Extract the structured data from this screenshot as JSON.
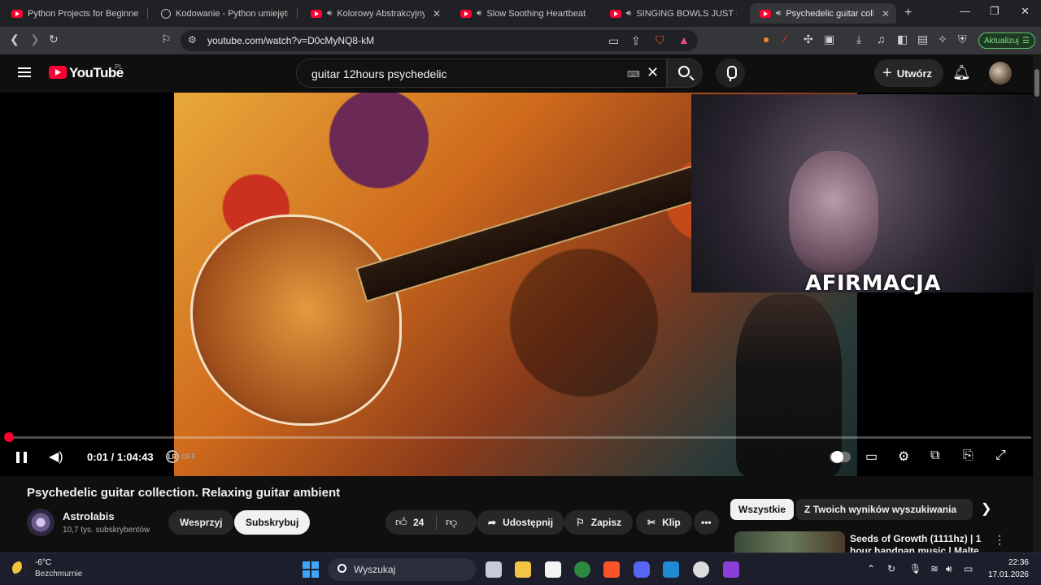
{
  "browser": {
    "tabs": [
      {
        "title": "Python Projects for Beginners –",
        "icon": "youtube-icon",
        "audio": false
      },
      {
        "title": "Kodowanie - Python umiejętność",
        "icon": "globe-icon",
        "audio": false
      },
      {
        "title": "Kolorowy Abstrakcyjny",
        "icon": "youtube-icon",
        "audio": true
      },
      {
        "title": "Slow Soothing Heartbeat So",
        "icon": "youtube-icon",
        "audio": true
      },
      {
        "title": "SINGING BOWLS JUST FOR",
        "icon": "youtube-icon",
        "audio": true
      },
      {
        "title": "Psychedelic guitar collec",
        "icon": "youtube-icon",
        "audio": true,
        "active": true
      }
    ],
    "url": "youtube.com/watch?v=D0cMyNQ8-kM",
    "update_label": "Aktualizuj"
  },
  "masthead": {
    "logo_text": "YouTube",
    "country_code": "PL",
    "search_query": "guitar 12hours psychedelic",
    "create_label": "Utwórz"
  },
  "player": {
    "overlay_text": "AFIRMACJA",
    "time_current": "0:01",
    "time_total": "1:04:43",
    "time_display": "0:01 / 1:04:43",
    "progress_fraction": 0.0003,
    "lr_label": "LR",
    "lr_state": "OFF"
  },
  "video": {
    "title": "Psychedelic guitar collection. Relaxing guitar ambient",
    "channel_name": "Astrolabis",
    "channel_subs": "10,7 tys. subskrybentów",
    "join_label": "Wesprzyj",
    "subscribe_label": "Subskrybuj",
    "likes": "24",
    "share_label": "Udostępnij",
    "save_label": "Zapisz",
    "clip_label": "Klip"
  },
  "sidebar": {
    "chips": [
      "Wszystkie",
      "Z Twoich wyników wyszukiwania"
    ],
    "recommendation": {
      "title": "Seeds of Growth (1111hz) | 1 hour handpan music | Malte"
    }
  },
  "taskbar": {
    "temperature": "-6°C",
    "weather": "Bezchmurnie",
    "search_placeholder": "Wyszukaj",
    "time": "22:36",
    "date": "17.01.2026"
  },
  "colors": {
    "yt_red": "#ff0033",
    "bg": "#0f0f0f",
    "update_green": "#7ddc8a"
  }
}
